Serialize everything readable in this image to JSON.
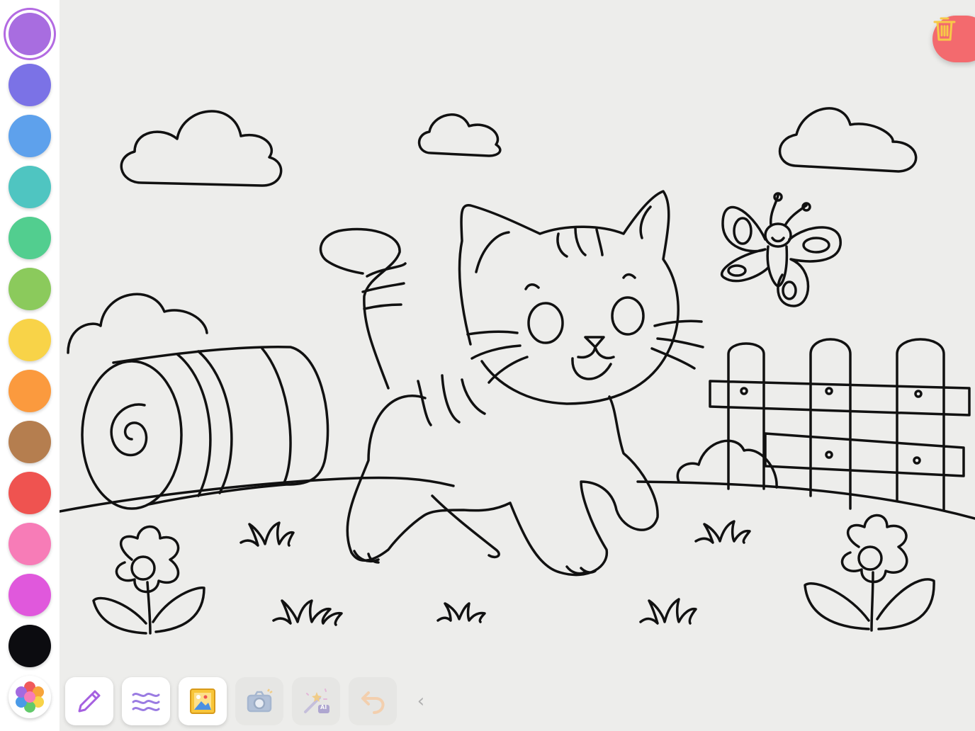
{
  "palette": {
    "selected_index": 0,
    "colors": [
      "#a86de0",
      "#7b72e6",
      "#5ea1ec",
      "#4fc5c1",
      "#52ce8f",
      "#8bca5c",
      "#f8d348",
      "#fb9a3e",
      "#b57e4f",
      "#ef5350",
      "#f77cb7",
      "#e058dc",
      "#0c0c10"
    ]
  },
  "icons": {
    "palette_picker": "color-wheel-icon",
    "trash": "trash-icon",
    "pen": "pen-icon",
    "brush": "wavy-lines-icon",
    "gallery": "picture-icon",
    "camera": "camera-icon",
    "magic": "magic-wand-ai-icon",
    "undo": "undo-icon",
    "collapse": "chevron-left-icon",
    "settings": "gear-icon"
  },
  "toolbar": {
    "magic_badge": "AI",
    "collapse_glyph": "‹"
  },
  "colors": {
    "trash_bg": "#f36a6e",
    "trash_icon": "#f7c948",
    "pen": "#a560e0",
    "brush": "#9a7be2",
    "undo": "#f5c69a"
  }
}
